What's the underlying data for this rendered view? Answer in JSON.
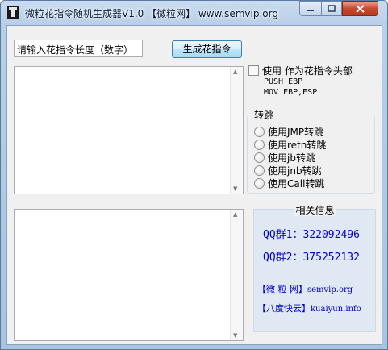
{
  "window": {
    "title": "微粒花指令随机生成器V1.0 【微粒网】 www.semvip.org",
    "colors": {
      "title_bar": "#b9cfe8",
      "close_button": "#c74a2f",
      "link_text": "#0000cc"
    }
  },
  "controls": {
    "length_input_value": "请输入花指令长度（数字）",
    "generate_button_label": "生成花指令"
  },
  "head_option": {
    "checkbox_label": "使用  作为花指令头部",
    "checked": false,
    "code_lines": [
      "PUSH EBP",
      "MOV EBP,ESP"
    ]
  },
  "jump_group": {
    "label": "转跳",
    "options": [
      "使用JMP转跳",
      "使用retn转跳",
      "使用jb转跳",
      "使用jnb转跳",
      "使用Call转跳"
    ]
  },
  "info": {
    "title": "相关信息",
    "qq1": "QQ群1：322092496",
    "qq2": "QQ群2：375252132",
    "link1_tag": "【微 粒 网】",
    "link1_site": "semvip.org",
    "link2_tag": "【八度快云】",
    "link2_site": "kuaiyun.info"
  },
  "icons": [
    "app-icon",
    "minimize-icon",
    "maximize-icon",
    "close-icon",
    "scroll-up-arrow-icon",
    "scroll-down-arrow-icon"
  ]
}
